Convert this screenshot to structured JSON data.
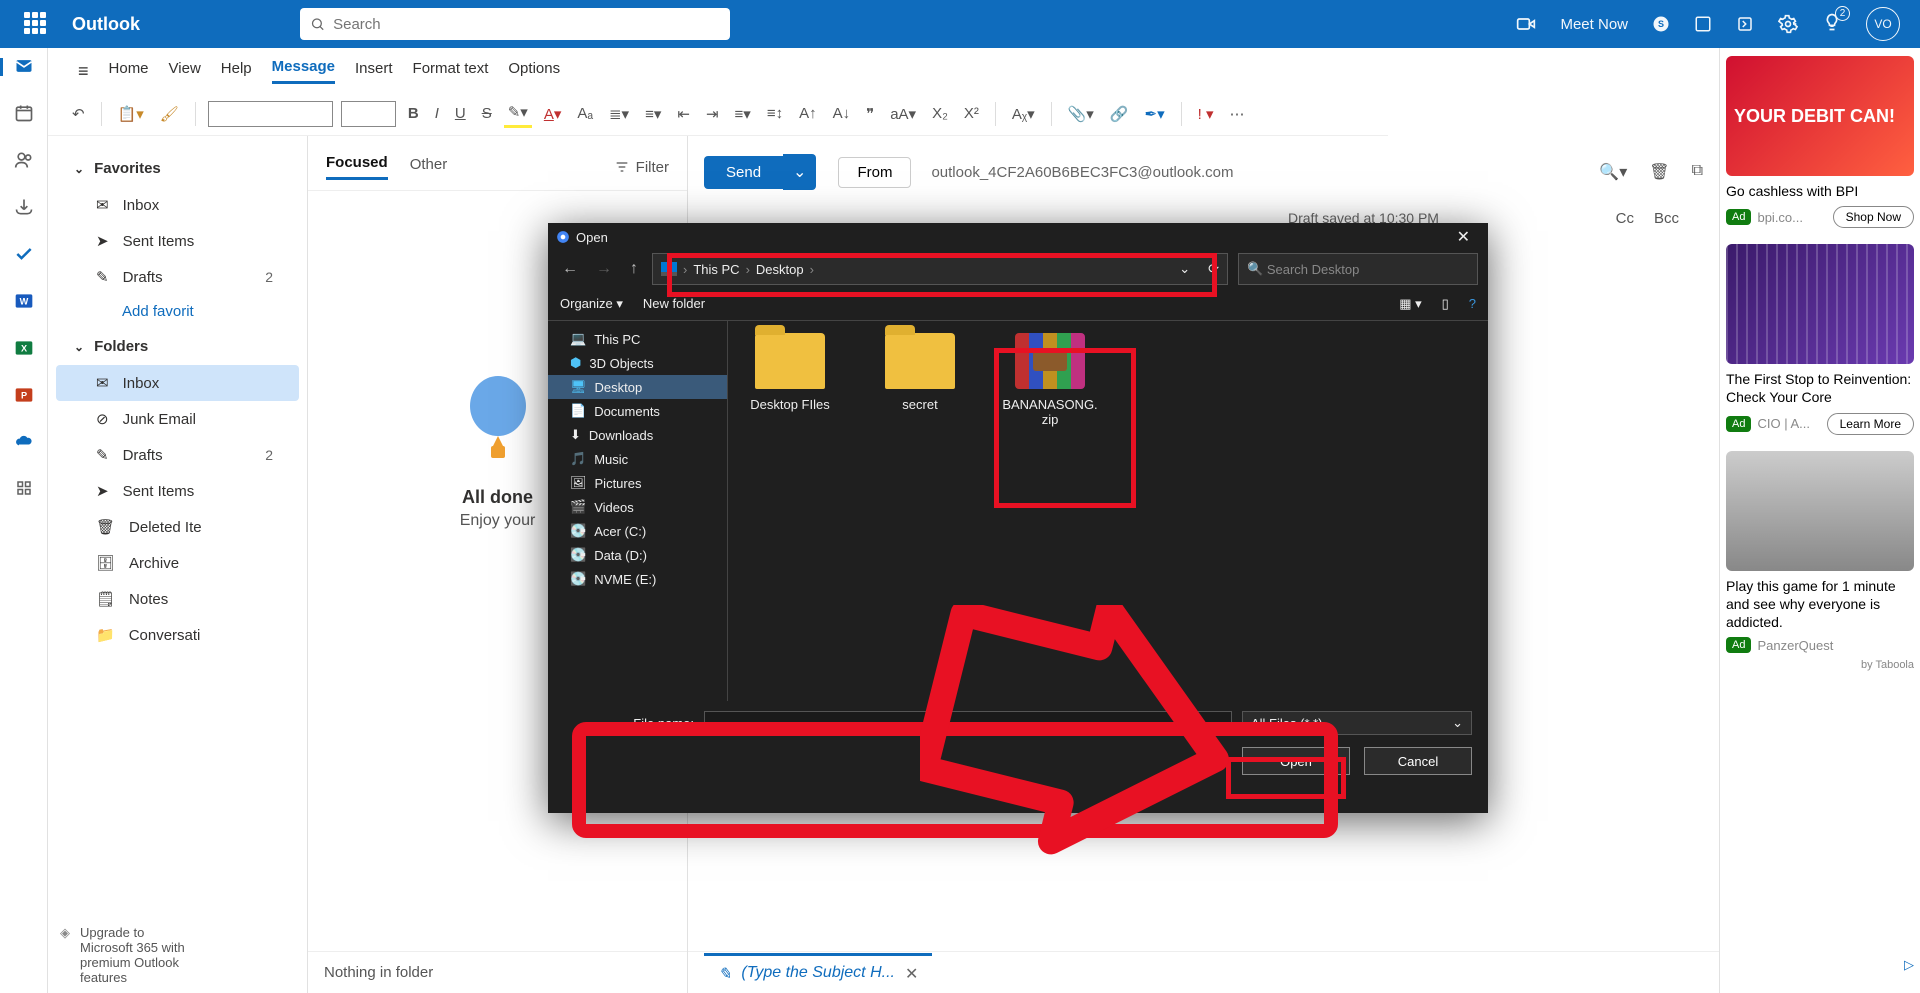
{
  "header": {
    "brand": "Outlook",
    "search_placeholder": "Search",
    "meet_now": "Meet Now",
    "notification_count": "2",
    "avatar_initials": "VO"
  },
  "ribbon": {
    "tabs": [
      "Home",
      "View",
      "Help",
      "Message",
      "Insert",
      "Format text",
      "Options"
    ],
    "active_tab": "Message"
  },
  "favorites": {
    "header": "Favorites",
    "items": [
      {
        "label": "Inbox",
        "count": ""
      },
      {
        "label": "Sent Items",
        "count": ""
      },
      {
        "label": "Drafts",
        "count": "2"
      }
    ],
    "add_label": "Add favorit"
  },
  "folders": {
    "header": "Folders",
    "items": [
      {
        "label": "Inbox",
        "selected": true
      },
      {
        "label": "Junk Email"
      },
      {
        "label": "Drafts",
        "count": "2"
      },
      {
        "label": "Sent Items"
      },
      {
        "label": "Deleted Ite"
      },
      {
        "label": "Archive"
      },
      {
        "label": "Notes"
      },
      {
        "label": "Conversati"
      }
    ]
  },
  "upgrade": {
    "line1": "Upgrade to",
    "line2": "Microsoft 365 with",
    "line3": "premium Outlook",
    "line4": "features"
  },
  "list": {
    "tab_focused": "Focused",
    "tab_other": "Other",
    "filter": "Filter",
    "done_title": "All done",
    "done_sub": "Enjoy your",
    "bottom_text": "Nothing in folder"
  },
  "compose": {
    "send": "Send",
    "from_label": "From",
    "from_address": "outlook_4CF2A60B6BEC3FC3@outlook.com",
    "cc": "Cc",
    "bcc": "Bcc",
    "draft_saved": "Draft saved at 10:30 PM",
    "subject_placeholder": "(Type the Subject H..."
  },
  "ads": {
    "ad1": {
      "title": "Go cashless with BPI",
      "publisher": "bpi.co...",
      "cta": "Shop Now",
      "hero": "YOUR DEBIT CAN!"
    },
    "ad2": {
      "title": "The First Stop to Reinvention: Check Your Core",
      "publisher": "CIO | A...",
      "cta": "Learn More"
    },
    "ad3": {
      "title": "Play this game for 1 minute and see why everyone is addicted.",
      "publisher": "PanzerQuest"
    },
    "badge": "Ad",
    "taboola": "by Taboola"
  },
  "dialog": {
    "title": "Open",
    "organize": "Organize",
    "new_folder": "New folder",
    "breadcrumb": [
      "This PC",
      "Desktop"
    ],
    "search_placeholder": "Search Desktop",
    "tree": [
      "This PC",
      "3D Objects",
      "Desktop",
      "Documents",
      "Downloads",
      "Music",
      "Pictures",
      "Videos",
      "Acer (C:)",
      "Data (D:)",
      "NVME (E:)"
    ],
    "tree_selected": "Desktop",
    "files": [
      {
        "name": "Desktop FIles",
        "type": "folder"
      },
      {
        "name": "secret",
        "type": "folder"
      },
      {
        "name": "BANANASONG.zip",
        "type": "zip"
      }
    ],
    "filename_label": "File name:",
    "filetype": "All Files (*.*)",
    "open_btn": "Open",
    "cancel_btn": "Cancel"
  }
}
